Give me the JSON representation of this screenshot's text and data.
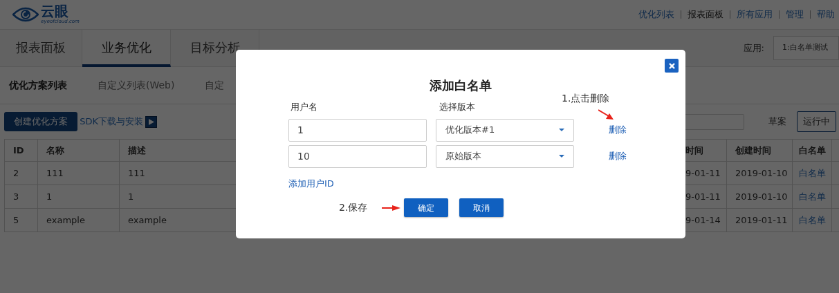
{
  "logo": {
    "name": "云眼",
    "domain": "eyeofcloud.com"
  },
  "top_links": [
    {
      "label": "优化列表",
      "selected": false
    },
    {
      "label": "报表面板",
      "selected": true
    },
    {
      "label": "所有应用",
      "selected": false
    },
    {
      "label": "管理",
      "selected": false
    },
    {
      "label": "帮助",
      "selected": false
    }
  ],
  "tabs": [
    {
      "label": "报表面板",
      "selected": false
    },
    {
      "label": "业务优化",
      "selected": true
    },
    {
      "label": "目标分析",
      "selected": false
    }
  ],
  "app_selector": {
    "label": "应用:",
    "value": "1:白名单测试"
  },
  "subnav": [
    {
      "label": "优化方案列表",
      "selected": true
    },
    {
      "label": "自定义列表(Web)",
      "selected": false
    },
    {
      "label": "自定",
      "selected": false
    }
  ],
  "toolbar": {
    "create_button": "创建优化方案",
    "sdk_link": "SDK下载与安装",
    "filters": [
      {
        "label": "草案",
        "selected": false
      },
      {
        "label": "运行中",
        "selected": true
      }
    ]
  },
  "table": {
    "columns": [
      "ID",
      "名称",
      "描述",
      "时间",
      "创建时间",
      "白名单"
    ],
    "rows": [
      {
        "cells": [
          "2",
          "111",
          "111",
          "9-01-11",
          "2019-01-10",
          "白名单"
        ]
      },
      {
        "cells": [
          "3",
          "1",
          "1",
          "9-01-11",
          "2019-01-10",
          "白名单"
        ]
      },
      {
        "cells": [
          "5",
          "example",
          "example",
          "9-01-14",
          "2019-01-11",
          "白名单"
        ]
      }
    ]
  },
  "dialog": {
    "title": "添加白名单",
    "user_label": "用户名",
    "version_label": "选择版本",
    "entries": [
      {
        "user": "1",
        "version": "优化版本#1",
        "delete": "删除"
      },
      {
        "user": "10",
        "version": "原始版本",
        "delete": "删除"
      }
    ],
    "add_link": "添加用户ID",
    "buttons": [
      "确定",
      "取消"
    ],
    "annotations": [
      {
        "text": "1.点击删除"
      },
      {
        "text": "2.保存"
      }
    ]
  }
}
